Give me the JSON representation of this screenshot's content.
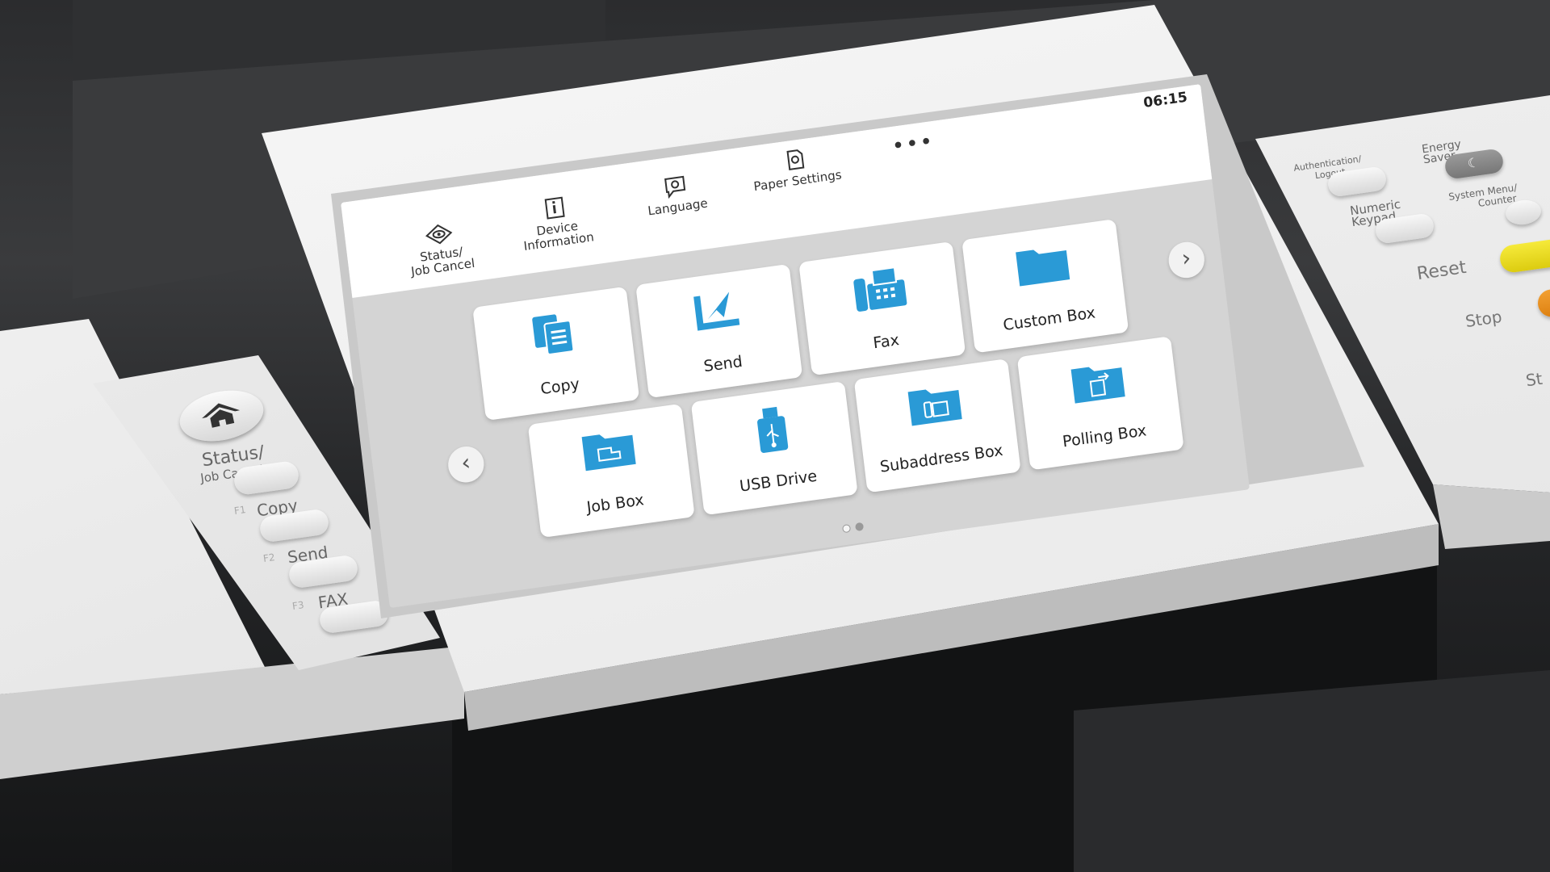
{
  "screen": {
    "time": "06:15",
    "shortcuts": [
      {
        "icon": "eye-icon",
        "label": "Status/\nJob Cancel",
        "l1": "Status/",
        "l2": "Job Cancel"
      },
      {
        "icon": "info-icon",
        "l1": "Device",
        "l2": "Information"
      },
      {
        "icon": "language-icon",
        "l1": "Language",
        "l2": ""
      },
      {
        "icon": "paper-settings-icon",
        "l1": "Paper Settings",
        "l2": ""
      }
    ],
    "more_label": "•••",
    "tiles_row1": [
      "Copy",
      "Send",
      "Fax",
      "Custom Box"
    ],
    "tiles_row2": [
      "Job Box",
      "USB Drive",
      "Subaddress Box",
      "Polling Box"
    ],
    "prev_arrow": "‹",
    "next_arrow": "›",
    "page_count": 2,
    "current_page": 1,
    "accent_color": "#2a9ad6"
  },
  "left_panel": {
    "status_label": "Status/",
    "status_label2": "Job Cancel",
    "f1": "F1",
    "copy": "Copy",
    "f2": "F2",
    "send": "Send",
    "f3": "F3",
    "fax": "FAX"
  },
  "right_panel": {
    "auth": "Authentication/\nLogout",
    "auth1": "Authentication/",
    "auth2": "Logout",
    "energy1": "Energy",
    "energy2": "Saver",
    "numeric1": "Numeric",
    "numeric2": "Keypad",
    "sysmenu1": "System Menu/",
    "sysmenu2": "Counter",
    "reset": "Reset",
    "stop": "Stop",
    "start": "St"
  }
}
